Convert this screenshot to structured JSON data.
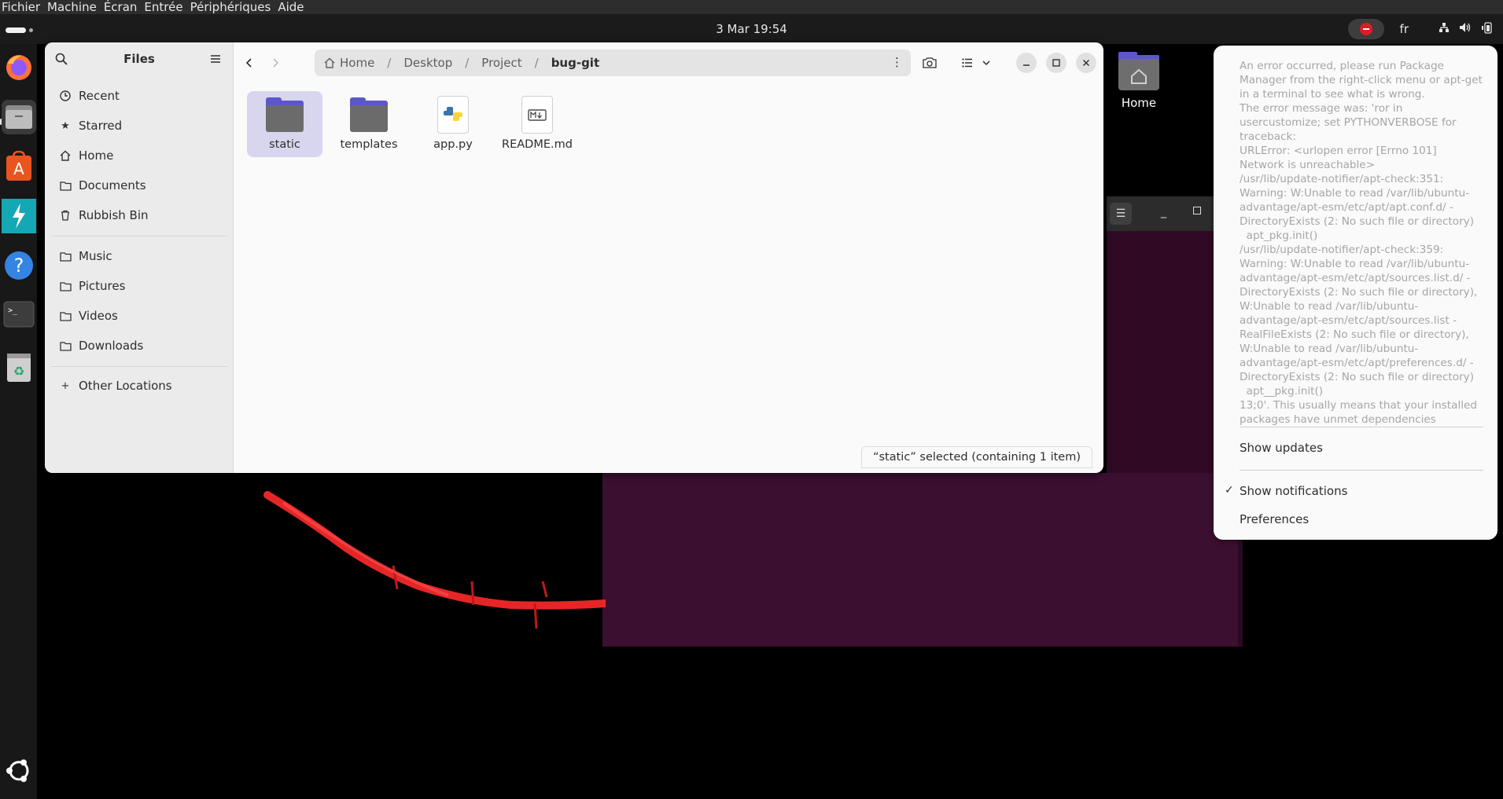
{
  "vm_menu": [
    "Fichier",
    "Machine",
    "Écran",
    "Entrée",
    "Périphériques",
    "Aide"
  ],
  "topbar": {
    "clock": "3 Mar  19:54",
    "keyboard_layout": "fr"
  },
  "dock": {
    "apps": [
      "firefox-icon",
      "files-icon",
      "app-center-icon",
      "bolt-icon",
      "help-icon",
      "terminal-icon",
      "trash-icon"
    ],
    "show_apps": "ubuntu-logo-icon"
  },
  "files": {
    "title": "Files",
    "sidebar": {
      "places": [
        "Recent",
        "Starred",
        "Home",
        "Documents",
        "Rubbish Bin"
      ],
      "bookmarks": [
        "Music",
        "Pictures",
        "Videos",
        "Downloads"
      ],
      "other": "Other Locations"
    },
    "pathbar": [
      "Home",
      "Desktop",
      "Project",
      "bug-git"
    ],
    "items": [
      {
        "name": "static",
        "kind": "folder",
        "selected": true
      },
      {
        "name": "templates",
        "kind": "folder",
        "selected": false
      },
      {
        "name": "app.py",
        "kind": "python",
        "selected": false
      },
      {
        "name": "README.md",
        "kind": "markdown",
        "selected": false
      }
    ],
    "status": "“static” selected  (containing 1 item)"
  },
  "desktop": {
    "home_label": "Home"
  },
  "notification_menu": {
    "message": "An error occurred, please run Package Manager from the right-click menu or apt-get in a terminal to see what is wrong.\nThe error message was: 'ror in usercustomize; set PYTHONVERBOSE for traceback:\nURLError: <urlopen error [Errno 101] Network is unreachable>\n/usr/lib/update-notifier/apt-check:351: Warning: W:Unable to read /var/lib/ubuntu-advantage/apt-esm/etc/apt/apt.conf.d/ - DirectoryExists (2: No such file or directory)\n  apt_pkg.init()\n/usr/lib/update-notifier/apt-check:359: Warning: W:Unable to read /var/lib/ubuntu-advantage/apt-esm/etc/apt/sources.list.d/ - DirectoryExists (2: No such file or directory), W:Unable to read /var/lib/ubuntu-advantage/apt-esm/etc/apt/sources.list - RealFileExists (2: No such file or directory), W:Unable to read /var/lib/ubuntu-advantage/apt-esm/etc/apt/preferences.d/ - DirectoryExists (2: No such file or directory)\n  apt__pkg.init()\n13;0'. This usually means that your installed packages have unmet dependencies",
    "show_updates": "Show updates",
    "show_notifications": "Show notifications",
    "preferences": "Preferences",
    "check": "✓"
  },
  "colors": {
    "accent": "#5c57c9",
    "selection": "#d7d6ee",
    "terminal_bg": "#300a24"
  }
}
